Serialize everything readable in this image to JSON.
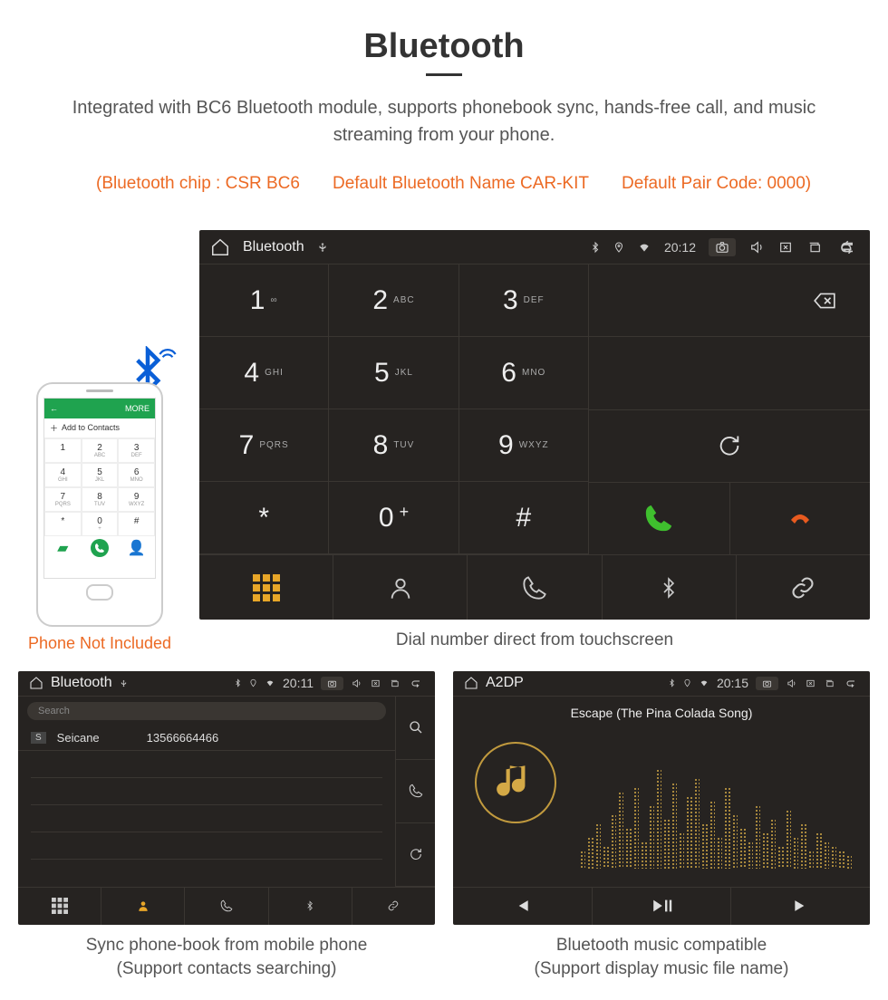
{
  "header": {
    "title": "Bluetooth",
    "description": "Integrated with BC6 Bluetooth module, supports phonebook sync, hands-free call, and music streaming from your phone.",
    "spec_chip": "(Bluetooth chip : CSR BC6",
    "spec_name": "Default Bluetooth Name CAR-KIT",
    "spec_code": "Default Pair Code: 0000)"
  },
  "phone": {
    "add_to_contacts": "Add to Contacts",
    "more": "MORE",
    "caption": "Phone Not Included",
    "keypad": [
      {
        "n": "1",
        "s": ""
      },
      {
        "n": "2",
        "s": "ABC"
      },
      {
        "n": "3",
        "s": "DEF"
      },
      {
        "n": "4",
        "s": "GHI"
      },
      {
        "n": "5",
        "s": "JKL"
      },
      {
        "n": "6",
        "s": "MNO"
      },
      {
        "n": "7",
        "s": "PQRS"
      },
      {
        "n": "8",
        "s": "TUV"
      },
      {
        "n": "9",
        "s": "WXYZ"
      },
      {
        "n": "*",
        "s": ""
      },
      {
        "n": "0",
        "s": "+"
      },
      {
        "n": "#",
        "s": ""
      }
    ]
  },
  "dialer": {
    "statusbar": {
      "title": "Bluetooth",
      "time": "20:12"
    },
    "keypad": [
      {
        "n": "1",
        "s": "∞"
      },
      {
        "n": "2",
        "s": "ABC"
      },
      {
        "n": "3",
        "s": "DEF"
      },
      {
        "n": "4",
        "s": "GHI"
      },
      {
        "n": "5",
        "s": "JKL"
      },
      {
        "n": "6",
        "s": "MNO"
      },
      {
        "n": "7",
        "s": "PQRS"
      },
      {
        "n": "8",
        "s": "TUV"
      },
      {
        "n": "9",
        "s": "WXYZ"
      },
      {
        "n": "*",
        "s": ""
      },
      {
        "n": "0",
        "s": "+"
      },
      {
        "n": "#",
        "s": ""
      }
    ],
    "caption": "Dial number direct from touchscreen"
  },
  "contacts": {
    "statusbar": {
      "title": "Bluetooth",
      "time": "20:11"
    },
    "search_placeholder": "Search",
    "entry_badge": "S",
    "entry_name": "Seicane",
    "entry_number": "13566664466",
    "caption_l1": "Sync phone-book from mobile phone",
    "caption_l2": "(Support contacts searching)"
  },
  "music": {
    "statusbar": {
      "title": "A2DP",
      "time": "20:15"
    },
    "track": "Escape (The Pina Colada Song)",
    "caption_l1": "Bluetooth music compatible",
    "caption_l2": "(Support display music file name)"
  }
}
